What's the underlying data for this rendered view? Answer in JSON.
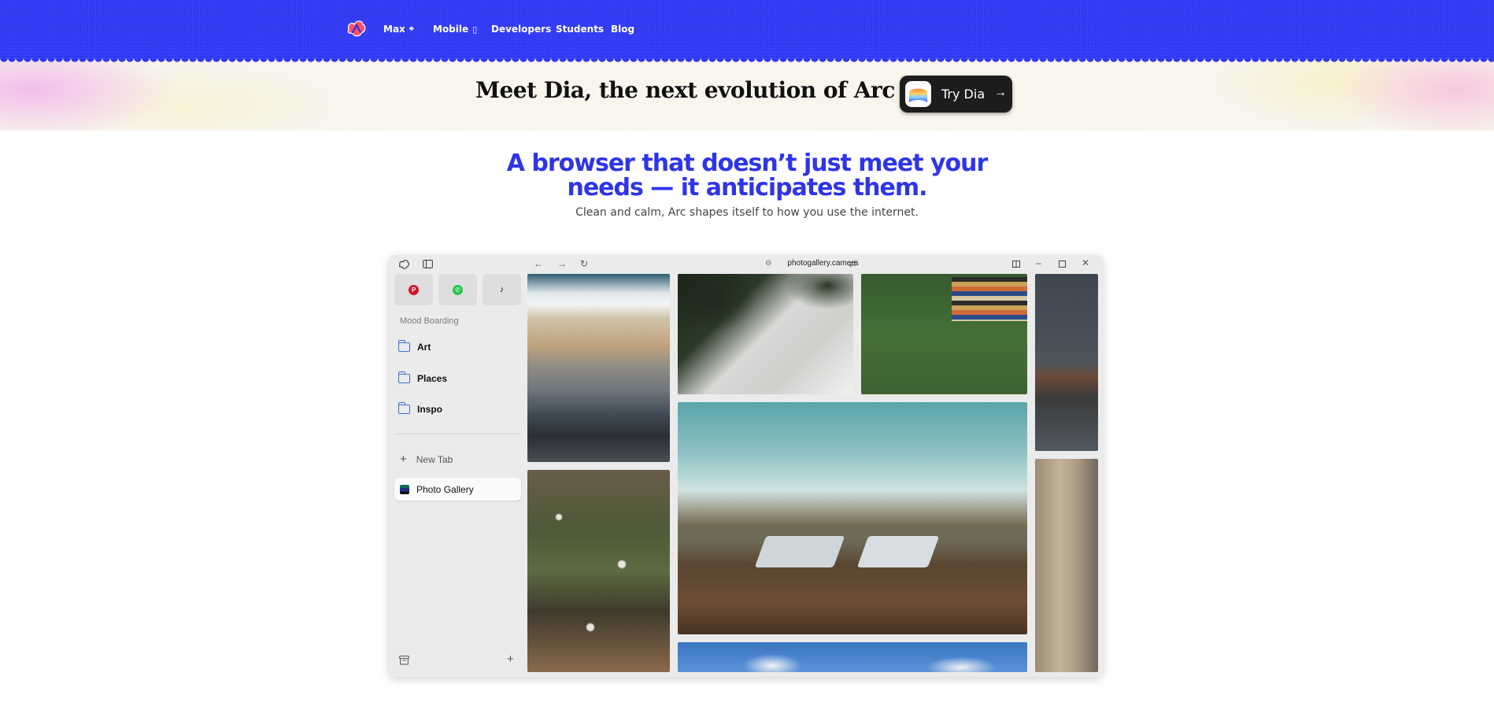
{
  "nav": {
    "items": [
      {
        "label": "Max",
        "glyph": "⌖"
      },
      {
        "label": "Mobile",
        "glyph": "▯"
      },
      {
        "label": "Developers"
      },
      {
        "label": "Students"
      },
      {
        "label": "Blog"
      }
    ]
  },
  "banner": {
    "title": "Meet Dia, the next evolution of Arc",
    "cta_label": "Try Dia",
    "cta_arrow": "→"
  },
  "hero": {
    "title_line1": "A browser that doesn’t just meet your",
    "title_line2": "needs — it anticipates them.",
    "subtitle": "Clean and calm, Arc shapes itself to how you use the internet."
  },
  "browser": {
    "url": "photogallery.camera",
    "sidebar": {
      "section_label": "Mood Boarding",
      "folders": [
        "Art",
        "Places",
        "Inspo"
      ],
      "new_tab_label": "New Tab",
      "active_tab_label": "Photo Gallery"
    }
  },
  "colors": {
    "nav_bg": "#3139f5",
    "hero_title": "#2e35e8",
    "banner_bg": "#f7f5ec",
    "cta_bg": "#1d1d1d"
  },
  "icons": [
    "arc-logo-icon",
    "sidebar-toggle-icon",
    "back-arrow-icon",
    "forward-arrow-icon",
    "reload-icon",
    "link-icon",
    "settings-icon",
    "split-view-icon",
    "minimize-icon",
    "maximize-icon",
    "close-icon",
    "pinterest-icon",
    "whatsapp-icon",
    "tiktok-icon",
    "folder-icon",
    "plus-icon",
    "archive-icon"
  ]
}
